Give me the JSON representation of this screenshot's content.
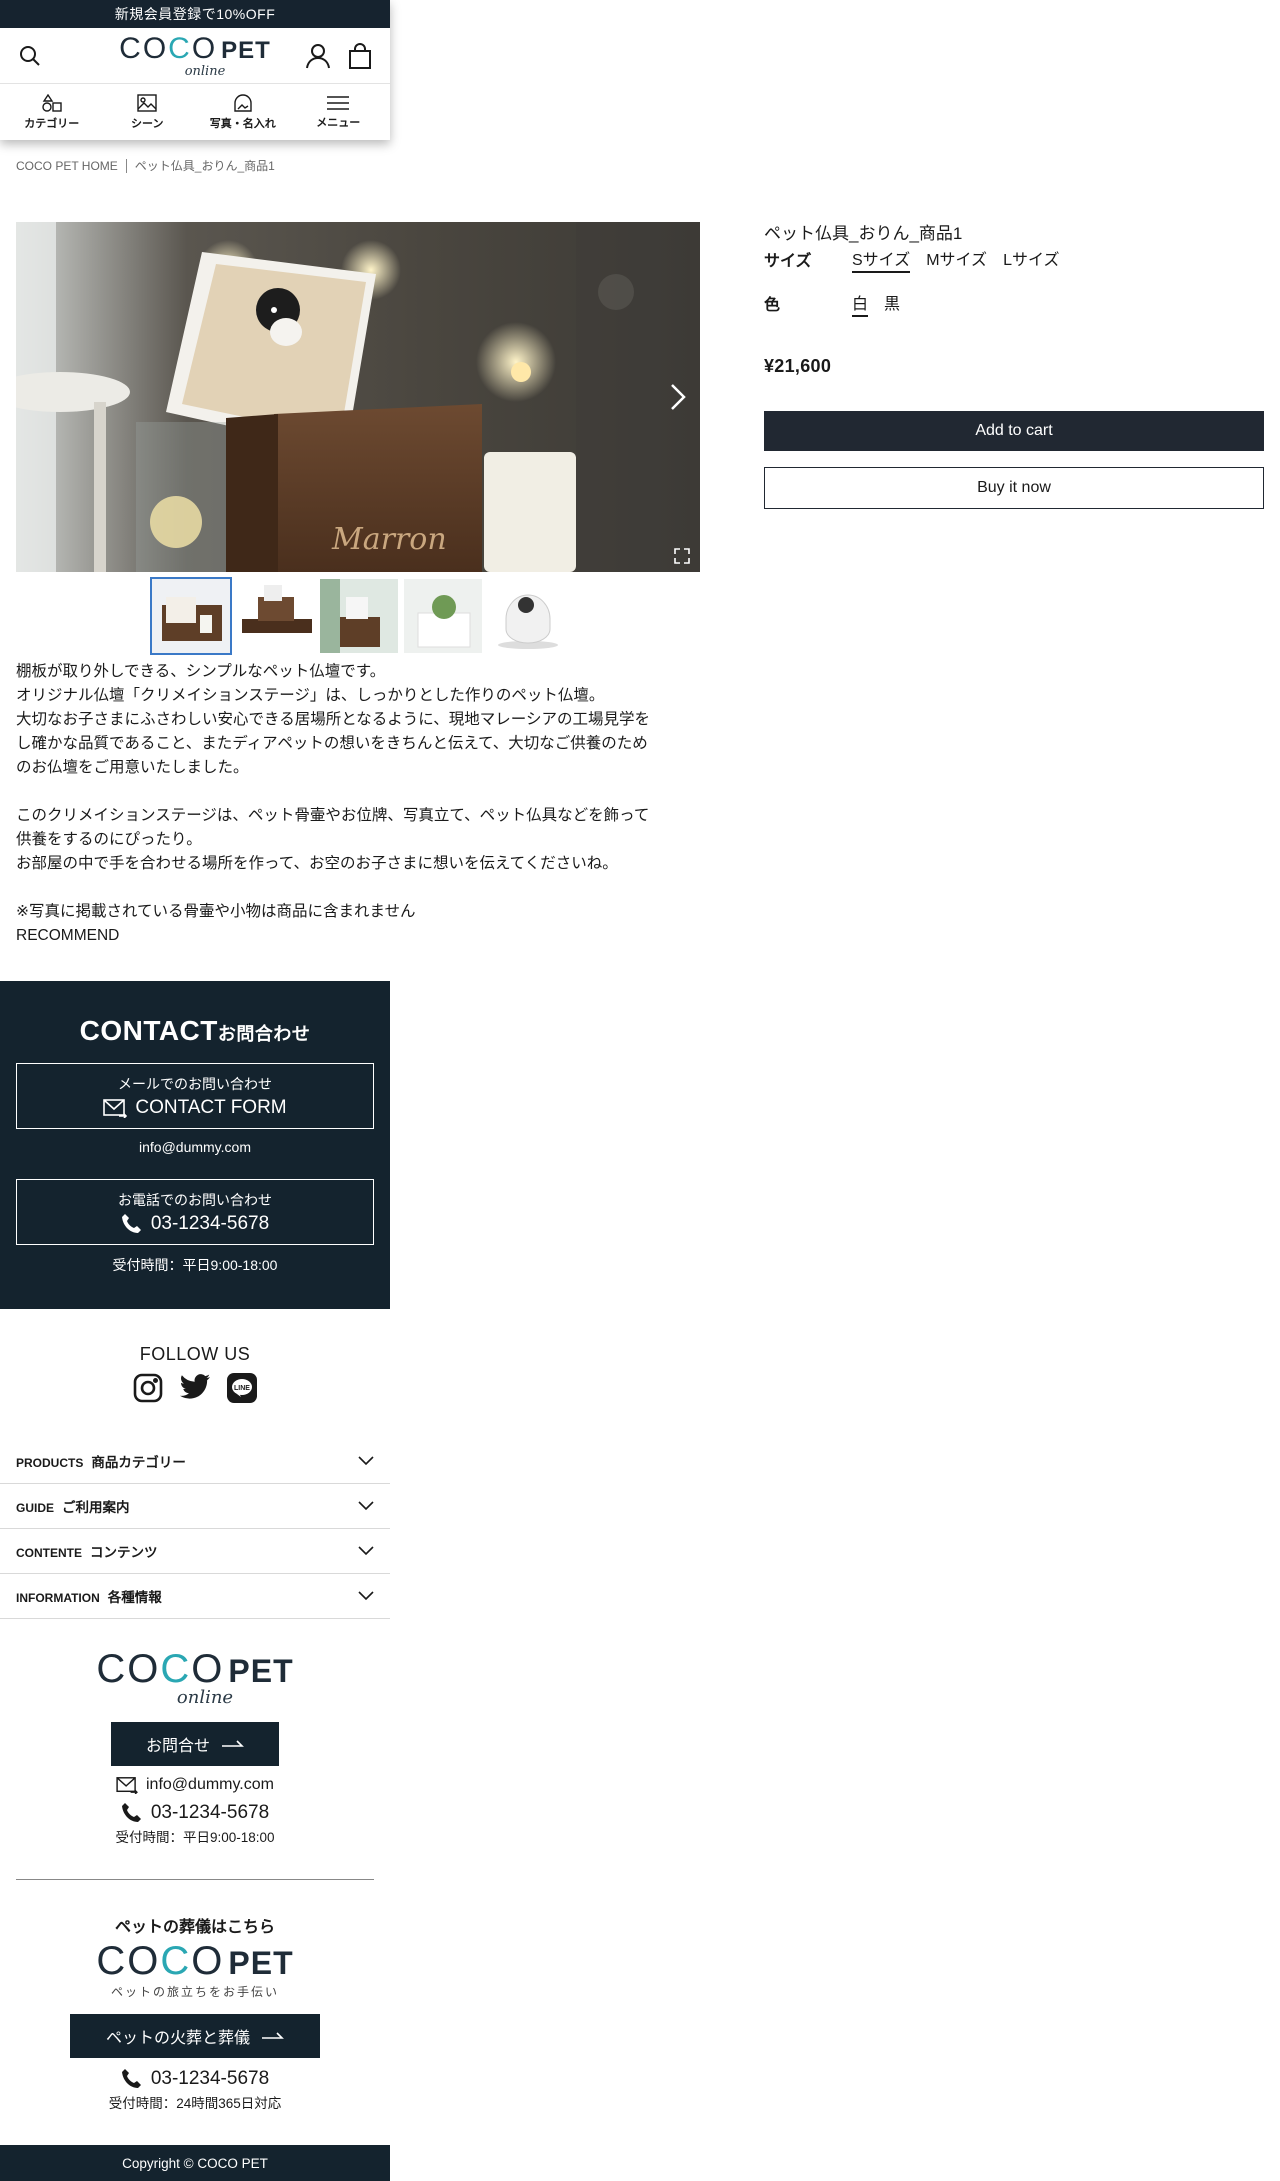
{
  "announcement": "新規会員登録で10%OFF",
  "header": {
    "logo_text_main": "COCOPET",
    "logo_text_sub": "online",
    "search_label": "search",
    "account_label": "account",
    "cart_label": "cart"
  },
  "nav": {
    "items": [
      {
        "label": "カテゴリー",
        "icon": "shapes-icon"
      },
      {
        "label": "シーン",
        "icon": "scene-icon"
      },
      {
        "label": "写真・名入れ",
        "icon": "photo-name-icon"
      },
      {
        "label": "メニュー",
        "icon": "menu-icon"
      }
    ]
  },
  "breadcrumb": {
    "home": "COCO PET HOME",
    "current": "ペット仏具_おりん_商品1"
  },
  "product": {
    "title": "ペット仏具_おりん_商品1",
    "size_label": "サイズ",
    "sizes": [
      "Sサイズ",
      "Mサイズ",
      "Lサイズ"
    ],
    "selected_size": "Sサイズ",
    "color_label": "色",
    "colors": [
      "白",
      "黒"
    ],
    "selected_color": "白",
    "price": "¥21,600",
    "add_to_cart": "Add to cart",
    "buy_now": "Buy it now",
    "image_engraving": "Marron"
  },
  "description": {
    "p1": "棚板が取り外しできる、シンプルなペット仏壇です。\nオリジナル仏壇「クリメイションステージ」は、しっかりとした作りのペット仏壇。\n大切なお子さまにふさわしい安心できる居場所となるように、現地マレーシアの工場見学を\nし確かな品質であること、またディアペットの想いをきちんと伝えて、大切なご供養のため\nのお仏壇をご用意いたしました。",
    "p2": "このクリメイションステージは、ペット骨壷やお位牌、写真立て、ペット仏具などを飾って\n供養をするのにぴったり。\nお部屋の中で手を合わせる場所を作って、お空のお子さまに想いを伝えてくださいね。",
    "p3": "※写真に掲載されている骨壷や小物は商品に含まれません",
    "recommend": "RECOMMEND"
  },
  "contact": {
    "title_en": "CONTACT",
    "title_ja": "お問合わせ",
    "mail_sub": "メールでのお問い合わせ",
    "mail_main": "CONTACT FORM",
    "email": "info@dummy.com",
    "phone_sub": "お電話でのお問い合わせ",
    "phone": "03-1234-5678",
    "hours": "受付時間：平日9:00-18:00"
  },
  "follow": {
    "title": "FOLLOW US",
    "icons": [
      "instagram-icon",
      "twitter-icon",
      "line-icon"
    ]
  },
  "accordion": [
    {
      "en": "PRODUCTS",
      "ja": "商品カテゴリー"
    },
    {
      "en": "GUIDE",
      "ja": "ご利用案内"
    },
    {
      "en": "CONTENTE",
      "ja": "コンテンツ"
    },
    {
      "en": "INFORMATION",
      "ja": "各種情報"
    }
  ],
  "footer": {
    "inquiry_button": "お問合せ",
    "email": "info@dummy.com",
    "phone": "03-1234-5678",
    "hours": "受付時間：平日9:00-18:00",
    "funeral_heading": "ペットの葬儀はこちら",
    "funeral_logo": "COCOPET",
    "funeral_tagline": "ペットの旅立ちをお手伝い",
    "funeral_button": "ペットの火葬と葬儀",
    "funeral_phone": "03-1234-5678",
    "funeral_hours": "受付時間：24時間365日対応",
    "copyright": "Copyright © COCO PET"
  },
  "colors": {
    "navy": "#14232e",
    "button_dark": "#212832",
    "accent_teal": "#2aa7b3",
    "thumb_active": "#3a79c7"
  }
}
